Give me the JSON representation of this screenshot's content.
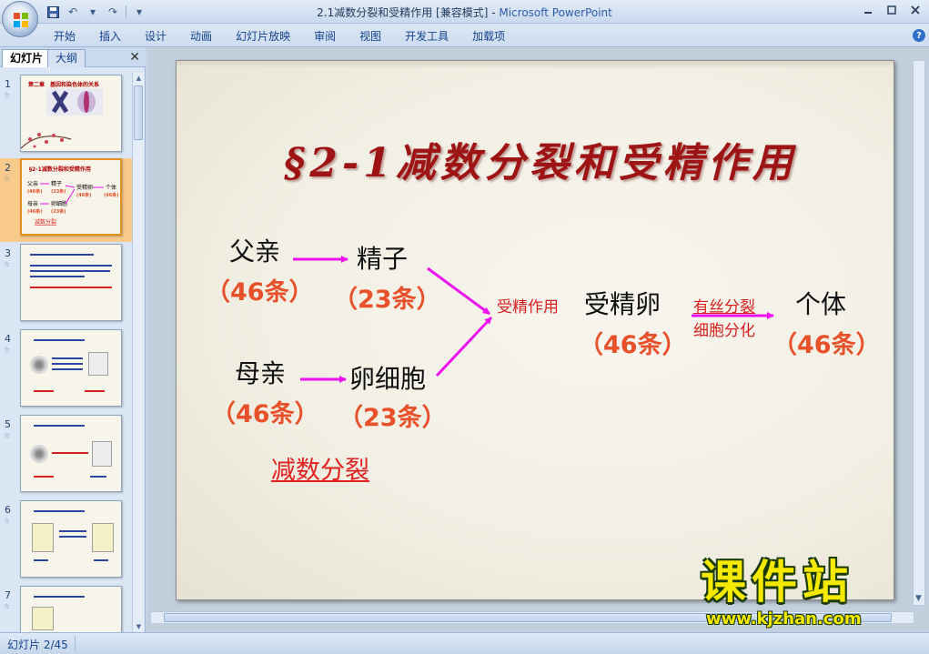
{
  "window": {
    "title": "2.1减数分裂和受精作用 [兼容模式] - ",
    "app_name": "Microsoft PowerPoint"
  },
  "qat": {
    "save_icon": "save-icon",
    "undo_icon": "undo-icon",
    "redo_icon": "redo-icon",
    "more_icon": "customize-icon"
  },
  "ribbon": {
    "tabs": [
      "开始",
      "插入",
      "设计",
      "动画",
      "幻灯片放映",
      "审阅",
      "视图",
      "开发工具",
      "加载项"
    ],
    "help": "?"
  },
  "left_panel": {
    "tab_slides": "幻灯片",
    "tab_outline": "大纲",
    "close": "✕",
    "thumbnails": [
      {
        "num": "1",
        "title": "第二章　基因和染色体的关系"
      },
      {
        "num": "2",
        "title": "§2-1减数分裂和受精作用",
        "selected": true
      },
      {
        "num": "3",
        "title": ""
      },
      {
        "num": "4",
        "title": ""
      },
      {
        "num": "5",
        "title": ""
      },
      {
        "num": "6",
        "title": ""
      },
      {
        "num": "7",
        "title": ""
      }
    ]
  },
  "slide": {
    "title": "§2-1减数分裂和受精作用",
    "father": "父亲",
    "father_count": "（46条）",
    "sperm": "精子",
    "sperm_count": "（23条）",
    "mother": "母亲",
    "mother_count": "（46条）",
    "egg": "卵细胞",
    "egg_count": "（23条）",
    "fertilization": "受精作用",
    "zygote": "受精卵",
    "zygote_count": "（46条）",
    "mitosis": "有丝分裂",
    "differentiation": "细胞分化",
    "individual": "个体",
    "individual_count": "（46条）",
    "meiosis": "减数分裂"
  },
  "watermark": {
    "title": "课件站",
    "url": "www.kjzhan.com"
  },
  "status": {
    "slide_counter": "幻灯片 2/45"
  },
  "colors": {
    "title": "#9e1414",
    "count": "#e8502a",
    "arrow": "#ee10ee",
    "label_red": "#d81f1f"
  }
}
